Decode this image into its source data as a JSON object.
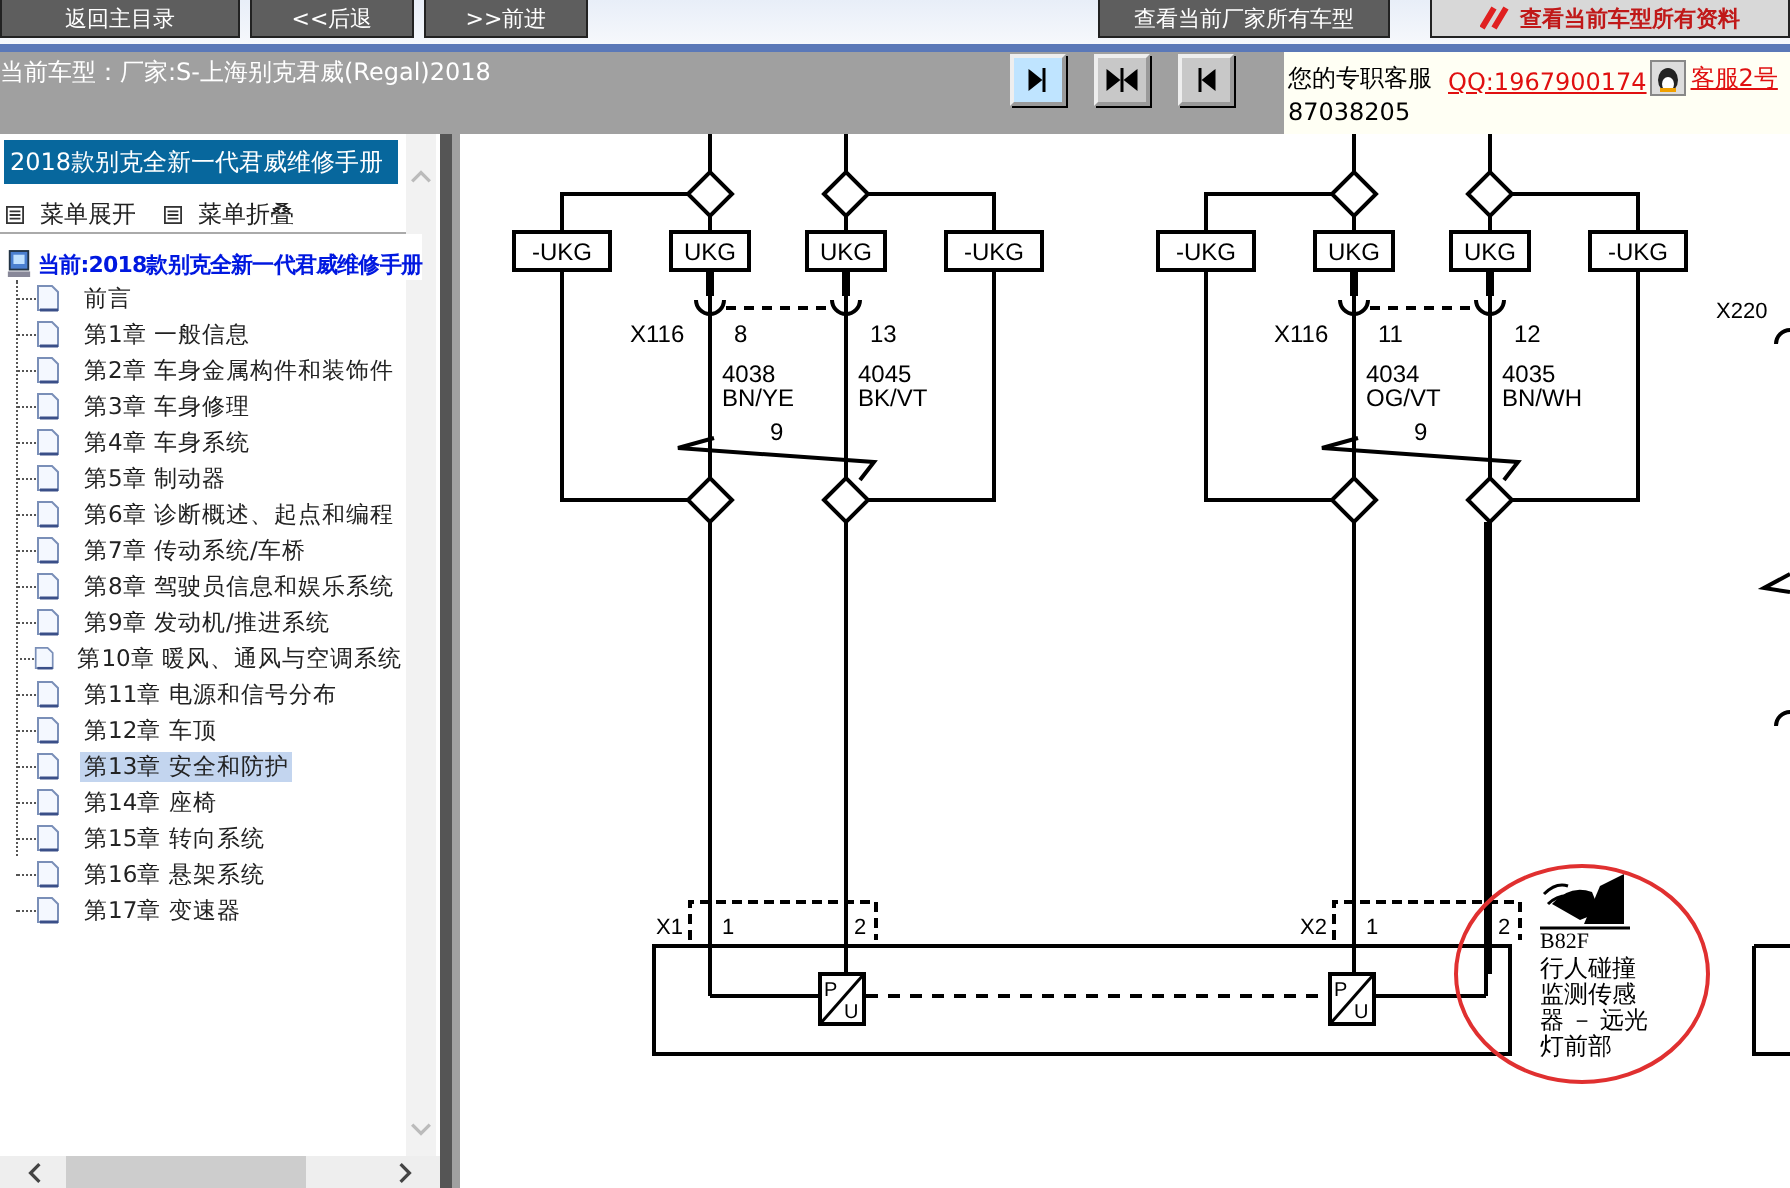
{
  "toolbar": {
    "left_buttons": [
      "返回主目录",
      "<<后退",
      ">>前进"
    ],
    "right_buttons": [
      {
        "label": "查看当前厂家所有车型",
        "kind": "plain"
      },
      {
        "label": "查看当前车型所有资料",
        "kind": "highlight"
      }
    ]
  },
  "info_bar": {
    "current_model": "当前车型：厂家:S-上海别克君威(Regal)2018",
    "view_buttons": [
      {
        "kind": "right",
        "selected": true
      },
      {
        "kind": "both",
        "selected": false
      },
      {
        "kind": "left",
        "selected": false
      }
    ]
  },
  "support": {
    "label": "您的专职客服",
    "qq": "QQ:1967900174",
    "agent": "客服2号",
    "phone": "87038205"
  },
  "sidebar": {
    "title": "2018款别克全新一代君威维修手册",
    "expand": "菜单展开",
    "collapse": "菜单折叠",
    "root": "当前:2018款别克全新一代君威维修手册",
    "items": [
      {
        "label": "前言",
        "selected": false
      },
      {
        "label": "第1章 一般信息",
        "selected": false
      },
      {
        "label": "第2章 车身金属构件和装饰件",
        "selected": false
      },
      {
        "label": "第3章 车身修理",
        "selected": false
      },
      {
        "label": "第4章 车身系统",
        "selected": false
      },
      {
        "label": "第5章 制动器",
        "selected": false
      },
      {
        "label": "第6章 诊断概述、起点和编程",
        "selected": false
      },
      {
        "label": "第7章 传动系统/车桥",
        "selected": false
      },
      {
        "label": "第8章 驾驶员信息和娱乐系统",
        "selected": false
      },
      {
        "label": "第9章 发动机/推进系统",
        "selected": false
      },
      {
        "label": "第10章 暖风、通风与空调系统",
        "selected": false
      },
      {
        "label": "第11章 电源和信号分布",
        "selected": false
      },
      {
        "label": "第12章 车顶",
        "selected": false
      },
      {
        "label": "第13章 安全和防护",
        "selected": true
      },
      {
        "label": "第14章 座椅",
        "selected": false
      },
      {
        "label": "第15章 转向系统",
        "selected": false
      },
      {
        "label": "第16章 悬架系统",
        "selected": false
      },
      {
        "label": "第17章 变速器",
        "selected": false
      }
    ]
  },
  "diagram": {
    "circuits": [
      {
        "blocks": [
          "-UKG",
          "UKG",
          "UKG",
          "-UKG"
        ],
        "connector": "X116",
        "twist": "9",
        "wires": [
          {
            "pin": "8",
            "number": "4038",
            "insulation": "BN/YE"
          },
          {
            "pin": "13",
            "number": "4045",
            "insulation": "BK/VT"
          }
        ]
      },
      {
        "blocks": [
          "-UKG",
          "UKG",
          "UKG",
          "-UKG"
        ],
        "connector": "X116",
        "twist": "9",
        "wires": [
          {
            "pin": "11",
            "number": "4034",
            "insulation": "OG/VT"
          },
          {
            "pin": "12",
            "number": "4035",
            "insulation": "BN/WH"
          }
        ]
      }
    ],
    "transducers": [
      {
        "input": "P",
        "output": "U"
      },
      {
        "input": "P",
        "output": "U"
      }
    ],
    "side_connector": "X220",
    "sensor_connectors": [
      {
        "label": "X1",
        "pins": [
          "1",
          "2"
        ]
      },
      {
        "label": "X2",
        "pins": [
          "1",
          "2"
        ]
      }
    ],
    "component": {
      "code": "B82F",
      "name": "行人碰撞监测传感器 － 远光灯前部"
    }
  }
}
